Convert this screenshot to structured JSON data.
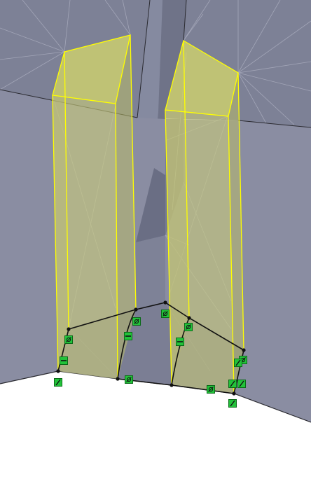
{
  "viewport": {
    "name": "cad-3d-graphics-area"
  },
  "colors": {
    "background": "#ffffff",
    "model_face_upper": "#7d8196",
    "model_face_back": "#70748a",
    "model_face_front": "#8a8da2",
    "model_face_ground": "#9295a8",
    "mesh_lines": "#a5a8ba",
    "edge_dark": "#2a2a30",
    "extrude_preview_fill": "#c9cc7a",
    "extrude_preview_edge": "#ffff00",
    "sketch_lines": "#111111",
    "relation_marker_fill": "#22c23a",
    "relation_marker_border": "#0a6a18"
  },
  "relation_markers": [
    {
      "id": "coincident",
      "icon": "coincident-relation-icon"
    },
    {
      "id": "horizontal",
      "icon": "horizontal-relation-icon"
    },
    {
      "id": "horizontal",
      "icon": "horizontal-relation-icon"
    },
    {
      "id": "horizontal",
      "icon": "horizontal-relation-icon"
    },
    {
      "id": "coincident",
      "icon": "coincident-relation-icon"
    },
    {
      "id": "coincident",
      "icon": "coincident-relation-icon"
    },
    {
      "id": "coincident",
      "icon": "coincident-relation-icon"
    },
    {
      "id": "coincident",
      "icon": "coincident-relation-icon"
    },
    {
      "id": "coincident",
      "icon": "coincident-relation-icon"
    },
    {
      "id": "coincident",
      "icon": "coincident-relation-icon"
    },
    {
      "id": "parallel",
      "icon": "parallel-relation-icon"
    },
    {
      "id": "parallel",
      "icon": "parallel-relation-icon"
    },
    {
      "id": "parallel",
      "icon": "parallel-relation-icon"
    },
    {
      "id": "parallel",
      "icon": "parallel-relation-icon"
    },
    {
      "id": "parallel",
      "icon": "parallel-relation-icon"
    }
  ]
}
